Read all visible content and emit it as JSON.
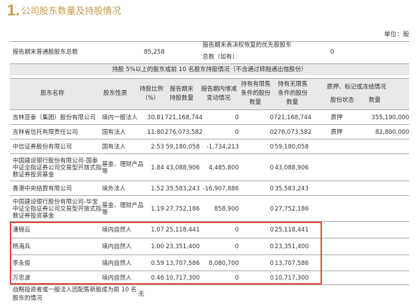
{
  "section": {
    "number": "1.",
    "title": "公司股东数量及持股情况"
  },
  "unit_label": "单位：股",
  "summary": {
    "label1": "报告期末普通股股东总数",
    "value1": "85,258",
    "label2a": "报告期末表决权恢复的优先股股东",
    "label2b": "总数（如有）",
    "value2": "0"
  },
  "top10_title": "持股 5%以上的股东或前 10 名股东持股情况（不含通过转融通出借股份）",
  "headers": {
    "name": "股东名称",
    "nature": "股东性质",
    "ratio_a": "持股比例",
    "ratio_b": "（%）",
    "shares_a": "报告期末",
    "shares_b": "持股数量",
    "change_a": "报告期内增减",
    "change_b": "变动情况",
    "restricted_a": "持有有限售",
    "restricted_b": "条件的股份",
    "restricted_c": "数量",
    "unrestricted_a": "持有无限售",
    "unrestricted_b": "条件的股份",
    "unrestricted_c": "数量",
    "pledge": "质押、标记或冻结情况",
    "pledge_status": "股份状态",
    "pledge_qty": "数量"
  },
  "rows": [
    {
      "name": "吉林亚泰（集团）股份有限公司",
      "nature": "境内一般法人",
      "ratio": "30.81",
      "shares": "721,168,744",
      "change": "0",
      "restricted": "0",
      "unrestricted": "721,168,744",
      "status": "质押",
      "qty": "355,190,000"
    },
    {
      "name": "吉林省信托有限责任公司",
      "nature": "国有法人",
      "ratio": "11.80",
      "shares": "276,073,582",
      "change": "0",
      "restricted": "0",
      "unrestricted": "276,073,582",
      "status": "质押",
      "qty": "82,800,000"
    },
    {
      "name": "中信证券股份有限公司",
      "nature": "国有法人",
      "ratio": "2.53",
      "shares": "59,180,058",
      "change": "-1,734,213",
      "restricted": "0",
      "unrestricted": "59,180,058",
      "status": "",
      "qty": ""
    },
    {
      "name": "中国建设银行股份有限公司-国泰中证全指证券公司交易型开放式指数证券投资基金",
      "nature": "基金、理财产品等",
      "ratio": "1.84",
      "shares": "43,088,906",
      "change": "4,485,800",
      "restricted": "0",
      "unrestricted": "43,088,906",
      "status": "",
      "qty": ""
    },
    {
      "name": "香港中央结算有限公司",
      "nature": "境外法人",
      "ratio": "1.52",
      "shares": "35,583,243",
      "change": "-16,907,886",
      "restricted": "0",
      "unrestricted": "35,583,243",
      "status": "",
      "qty": ""
    },
    {
      "name": "中国建设银行股份有限公司-华宝中证全指证券公司交易型开放式指数证券投资基金",
      "nature": "基金、理财产品等",
      "ratio": "1.19",
      "shares": "27,752,186",
      "change": "858,900",
      "restricted": "0",
      "unrestricted": "27,752,186",
      "status": "",
      "qty": ""
    },
    {
      "name": "潘锦云",
      "nature": "境内自然人",
      "ratio": "1.07",
      "shares": "25,118,441",
      "change": "0",
      "restricted": "0",
      "unrestricted": "25,118,441",
      "status": "",
      "qty": ""
    },
    {
      "name": "杨海兵",
      "nature": "境内自然人",
      "ratio": "1.00",
      "shares": "23,351,400",
      "change": "0",
      "restricted": "0",
      "unrestricted": "23,351,400",
      "status": "",
      "qty": ""
    },
    {
      "name": "李永俊",
      "nature": "境内自然人",
      "ratio": "0.59",
      "shares": "13,707,586",
      "change": "8,080,700",
      "restricted": "0",
      "unrestricted": "13,707,586",
      "status": "",
      "qty": ""
    },
    {
      "name": "万忠波",
      "nature": "境内自然人",
      "ratio": "0.46",
      "shares": "10,717,300",
      "change": "0",
      "restricted": "0",
      "unrestricted": "10,717,300",
      "status": "",
      "qty": ""
    }
  ],
  "footer": {
    "label_a": "战略投资者或一般法人因配售新股成为前 10 名",
    "label_b": "股东的情况",
    "value": "无"
  }
}
